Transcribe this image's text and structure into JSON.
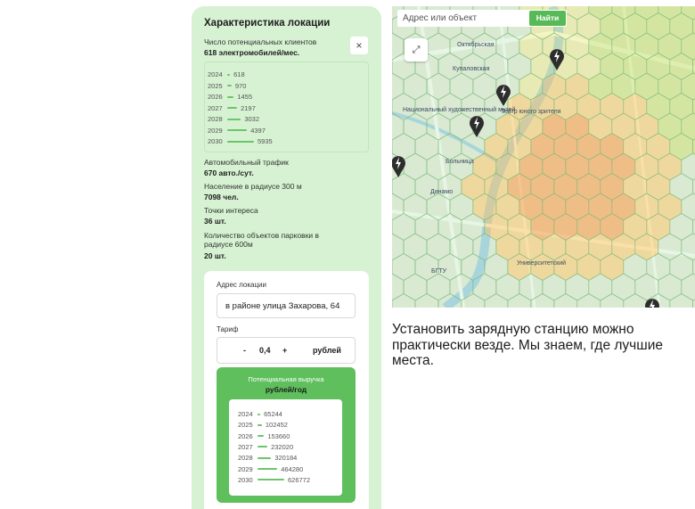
{
  "location": {
    "title": "Характеристика локации",
    "close_icon": "×",
    "clients_label": "Число потенциальных клиентов",
    "clients_value": "618 электромобилей/мес.",
    "forecast": [
      {
        "year": "2024",
        "value": 618
      },
      {
        "year": "2025",
        "value": 970
      },
      {
        "year": "2026",
        "value": 1455
      },
      {
        "year": "2027",
        "value": 2197
      },
      {
        "year": "2028",
        "value": 3032
      },
      {
        "year": "2029",
        "value": 4397
      },
      {
        "year": "2030",
        "value": 5935
      }
    ],
    "traffic_label": "Автомобильный трафик",
    "traffic_value": "670 авто./сут.",
    "population_label": "Население в радиусе 300 м",
    "population_value": "7098 чел.",
    "poi_label": "Точки интереса",
    "poi_value": "36 шт.",
    "parking_label_1": "Количество объектов парковки в",
    "parking_label_2": "радиусе 600м",
    "parking_value": "20 шт."
  },
  "calculator": {
    "address_label": "Адрес локации",
    "address_value": "в районе улица Захарова, 64",
    "tariff_label": "Тариф",
    "minus": "-",
    "tariff_value": "0,4",
    "plus": "+",
    "currency": "рублей",
    "revenue_title": "Потенциальная выручка",
    "revenue_unit": "рублей/год",
    "revenue": [
      {
        "year": "2024",
        "value": 65244
      },
      {
        "year": "2025",
        "value": 102452
      },
      {
        "year": "2026",
        "value": 153660
      },
      {
        "year": "2027",
        "value": 232020
      },
      {
        "year": "2028",
        "value": 320184
      },
      {
        "year": "2029",
        "value": 464280
      },
      {
        "year": "2030",
        "value": 626772
      }
    ]
  },
  "map": {
    "search_placeholder": "Адрес или объект",
    "search_button": "Найти",
    "expand_icon": "expand-icon",
    "labels": [
      "Октябрьская",
      "Купаловская",
      "Национальный художественный музей",
      "Театр юного зрителя",
      "Больница",
      "Динамо",
      "БГТУ",
      "Университетский"
    ]
  },
  "promo": {
    "text": "Установить зарядную станцию можно практически везде. Мы знаем, где лучшие места."
  },
  "colors": {
    "panel_bg": "#d6f2d2",
    "accent": "#5fbf5c",
    "bar": "#6cc56a"
  }
}
